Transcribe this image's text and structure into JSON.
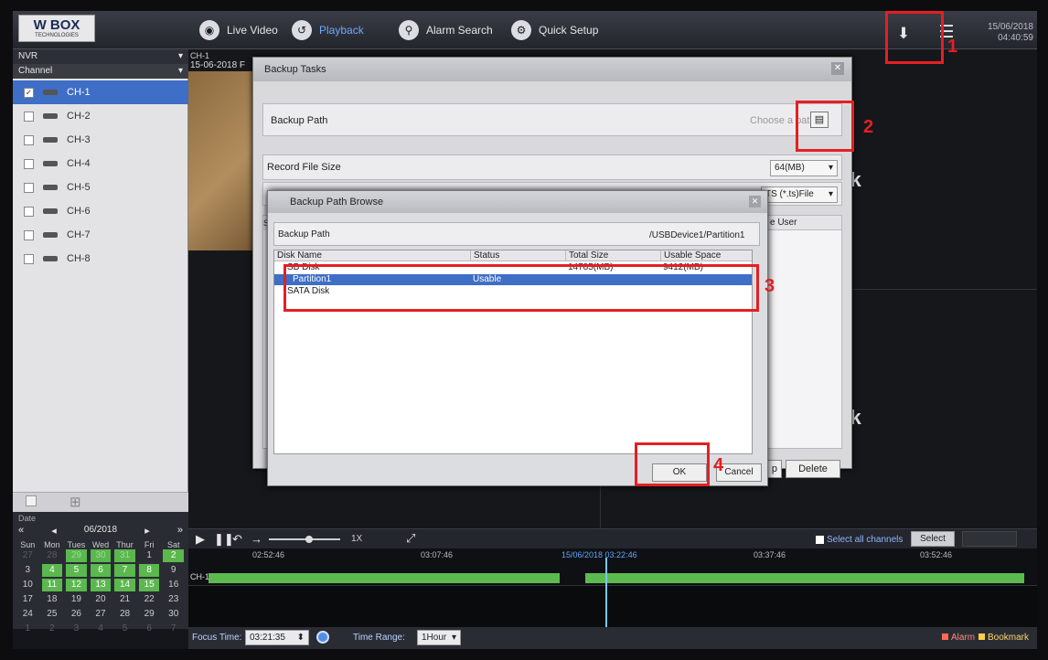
{
  "app": {
    "logo": "W BOX",
    "logo_sub": "TECHNOLOGIES",
    "nav": [
      {
        "label": "Live Video",
        "icon": "live-video-icon"
      },
      {
        "label": "Playback",
        "icon": "playback-icon",
        "active": true
      },
      {
        "label": "Alarm Search",
        "icon": "alarm-search-icon"
      },
      {
        "label": "Quick Setup",
        "icon": "quick-setup-icon"
      }
    ],
    "date": "15/06/2018",
    "time": "04:40:59"
  },
  "sidebar": {
    "nvr": "NVR",
    "channel_header": "Channel",
    "channels": [
      {
        "label": "CH-1",
        "checked": true
      },
      {
        "label": "CH-2",
        "checked": false
      },
      {
        "label": "CH-3",
        "checked": false
      },
      {
        "label": "CH-4",
        "checked": false
      },
      {
        "label": "CH-5",
        "checked": false
      },
      {
        "label": "CH-6",
        "checked": false
      },
      {
        "label": "CH-7",
        "checked": false
      },
      {
        "label": "CH-8",
        "checked": false
      }
    ]
  },
  "calendar": {
    "label": "Date",
    "month": "06/2018",
    "weekdays": [
      "Sun",
      "Mon",
      "Tues",
      "Wed",
      "Thur",
      "Fri",
      "Sat"
    ],
    "weeks": [
      [
        {
          "d": "27",
          "dim": true,
          "g": false
        },
        {
          "d": "28",
          "dim": true,
          "g": false
        },
        {
          "d": "29",
          "dim": true,
          "g": true
        },
        {
          "d": "30",
          "dim": true,
          "g": true
        },
        {
          "d": "31",
          "dim": true,
          "g": true
        },
        {
          "d": "1",
          "dim": false,
          "g": false
        },
        {
          "d": "2",
          "dim": false,
          "g": true
        }
      ],
      [
        {
          "d": "3",
          "dim": false,
          "g": false
        },
        {
          "d": "4",
          "dim": false,
          "g": true
        },
        {
          "d": "5",
          "dim": false,
          "g": true
        },
        {
          "d": "6",
          "dim": false,
          "g": true
        },
        {
          "d": "7",
          "dim": false,
          "g": true
        },
        {
          "d": "8",
          "dim": false,
          "g": true
        },
        {
          "d": "9",
          "dim": false,
          "g": false
        }
      ],
      [
        {
          "d": "10",
          "dim": false,
          "g": false
        },
        {
          "d": "11",
          "dim": false,
          "g": true
        },
        {
          "d": "12",
          "dim": false,
          "g": true
        },
        {
          "d": "13",
          "dim": false,
          "g": true
        },
        {
          "d": "14",
          "dim": false,
          "g": true
        },
        {
          "d": "15",
          "dim": false,
          "g": true
        },
        {
          "d": "16",
          "dim": false,
          "g": false
        }
      ],
      [
        {
          "d": "17",
          "dim": false,
          "g": false
        },
        {
          "d": "18",
          "dim": false,
          "g": false
        },
        {
          "d": "19",
          "dim": false,
          "g": false
        },
        {
          "d": "20",
          "dim": false,
          "g": false
        },
        {
          "d": "21",
          "dim": false,
          "g": false
        },
        {
          "d": "22",
          "dim": false,
          "g": false
        },
        {
          "d": "23",
          "dim": false,
          "g": false
        }
      ],
      [
        {
          "d": "24",
          "dim": false,
          "g": false
        },
        {
          "d": "25",
          "dim": false,
          "g": false
        },
        {
          "d": "26",
          "dim": false,
          "g": false
        },
        {
          "d": "27",
          "dim": false,
          "g": false
        },
        {
          "d": "28",
          "dim": false,
          "g": false
        },
        {
          "d": "29",
          "dim": false,
          "g": false
        },
        {
          "d": "30",
          "dim": false,
          "g": false
        }
      ],
      [
        {
          "d": "1",
          "dim": true,
          "g": false
        },
        {
          "d": "2",
          "dim": true,
          "g": false
        },
        {
          "d": "3",
          "dim": true,
          "g": false
        },
        {
          "d": "4",
          "dim": true,
          "g": false
        },
        {
          "d": "5",
          "dim": true,
          "g": false
        },
        {
          "d": "6",
          "dim": true,
          "g": false
        },
        {
          "d": "7",
          "dim": true,
          "g": false
        }
      ]
    ]
  },
  "main": {
    "channel_label": "CH-1",
    "timestamp": "15-06-2018 F",
    "no_link": "nk"
  },
  "backup_tasks": {
    "title": "Backup Tasks",
    "path_label": "Backup Path",
    "path_placeholder": "Choose a path",
    "size_label": "Record File Size",
    "size_value": "64(MB)",
    "format_value": "TS (*.ts)File",
    "col_s": "S",
    "col_user": "e User",
    "partial_btn": "p",
    "delete_btn": "Delete"
  },
  "browse": {
    "title": "Backup Path Browse",
    "path_label": "Backup Path",
    "path_value": "/USBDevice1/Partition1",
    "columns": [
      "Disk Name",
      "Status",
      "Total Size",
      "Usable Space"
    ],
    "rows": [
      {
        "name": "SB Disk",
        "status": "",
        "total": "14785(MB)",
        "usable": "9412(MB)",
        "selected": false
      },
      {
        "name": "Partition1",
        "status": "Usable",
        "total": "",
        "usable": "",
        "selected": true
      },
      {
        "name": "SATA Disk",
        "status": "",
        "total": "",
        "usable": "",
        "selected": false
      }
    ],
    "ok": "OK",
    "cancel": "Cancel"
  },
  "annotations": {
    "n1": "1",
    "n2": "2",
    "n3": "3",
    "n4": "4",
    "color": "#e41f24"
  },
  "playback": {
    "speed": "1X",
    "select_all": "Select all channels",
    "select_btn": "Select"
  },
  "timeline": {
    "ticks": [
      "02:52:46",
      "03:07:46",
      "15/06/2018 03:22:46",
      "03:37:46",
      "03:52:46"
    ],
    "channel": "CH-1"
  },
  "status": {
    "focus_label": "Focus Time:",
    "focus_value": "03:21:35",
    "range_label": "Time Range:",
    "range_value": "1Hour",
    "alarm": "Alarm",
    "bookmark": "Bookmark",
    "alarm_color": "#ff6a55",
    "bookmark_color": "#ffd046"
  }
}
